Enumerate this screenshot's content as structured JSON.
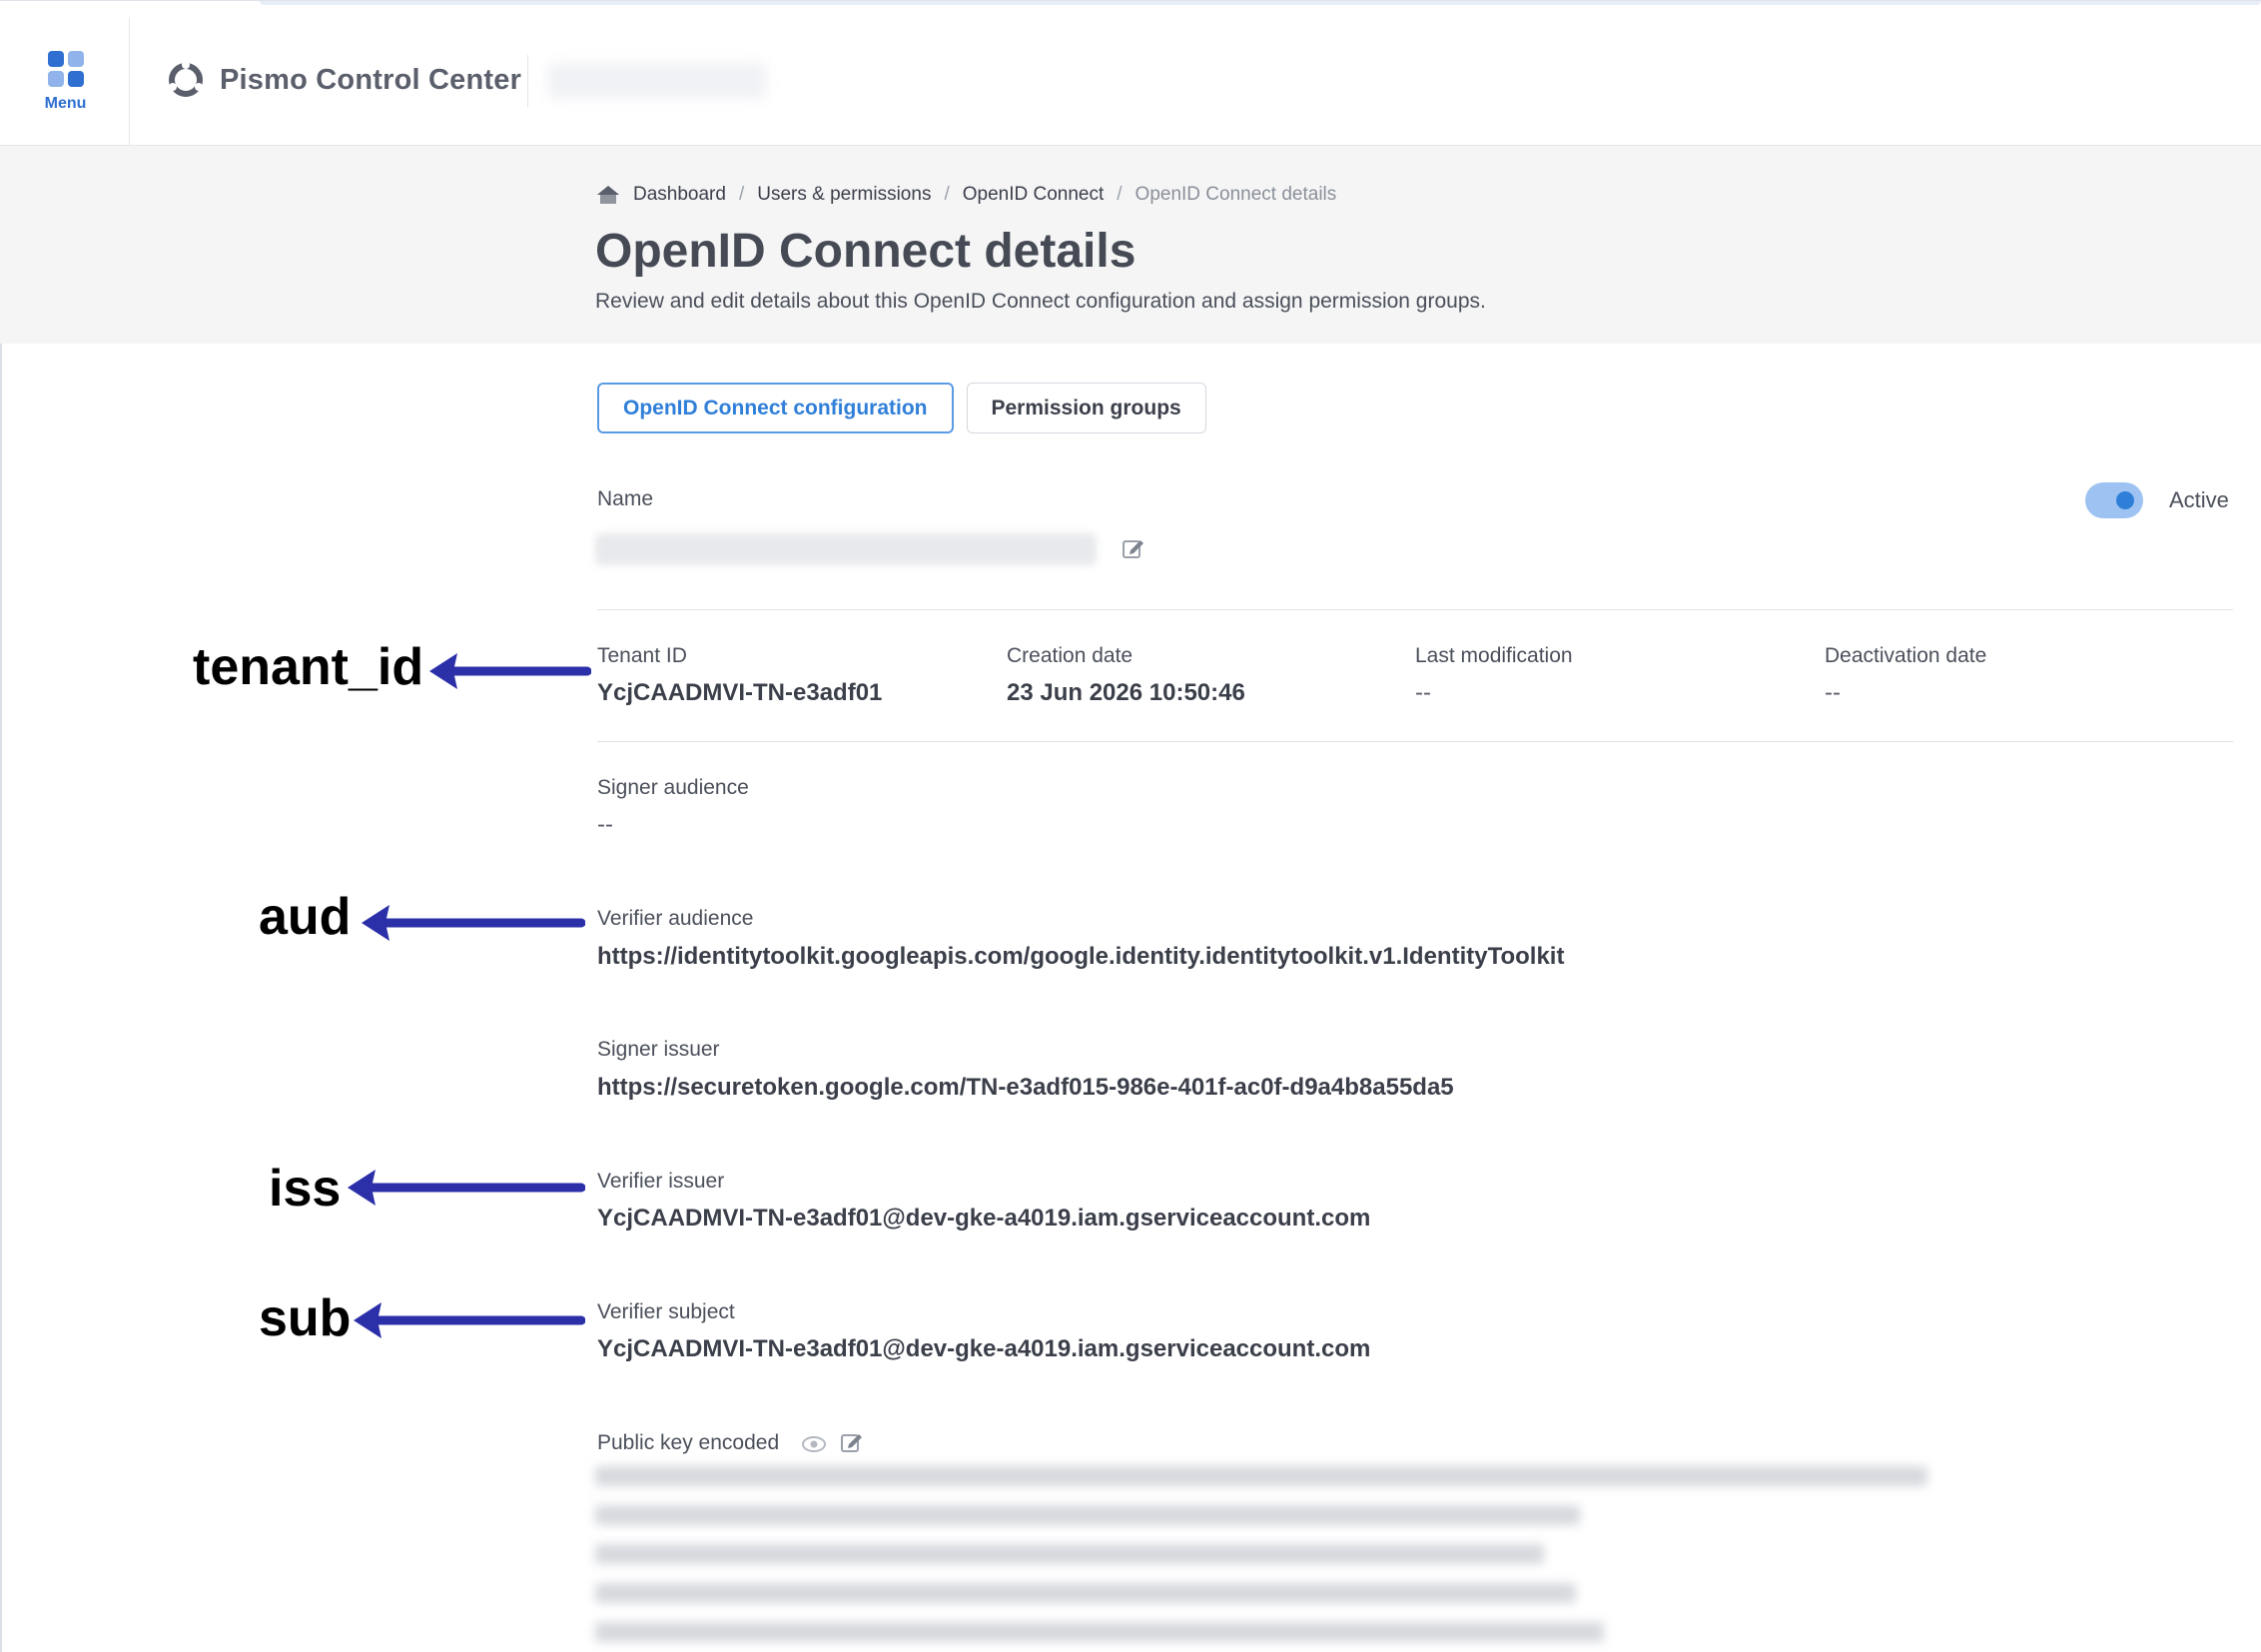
{
  "topbar": {
    "menu_label": "Menu",
    "brand_name": "Pismo Control Center"
  },
  "breadcrumb": {
    "items": [
      "Dashboard",
      "Users & permissions",
      "OpenID Connect",
      "OpenID Connect details"
    ],
    "separator": "/"
  },
  "header": {
    "title": "OpenID Connect details",
    "subtitle": "Review and edit details about this OpenID Connect configuration and assign permission groups."
  },
  "tabs": [
    {
      "label": "OpenID Connect configuration",
      "active": true
    },
    {
      "label": "Permission groups",
      "active": false
    }
  ],
  "details": {
    "name_label": "Name",
    "status_label": "Active",
    "status_on": true,
    "tenant_id_label": "Tenant ID",
    "tenant_id_value": "YcjCAADMVI-TN-e3adf01",
    "creation_date_label": "Creation date",
    "creation_date_value": "23 Jun 2026 10:50:46",
    "last_modification_label": "Last modification",
    "last_modification_value": "--",
    "deactivation_date_label": "Deactivation date",
    "deactivation_date_value": "--",
    "signer_audience_label": "Signer audience",
    "signer_audience_value": "--",
    "verifier_audience_label": "Verifier audience",
    "verifier_audience_value": "https://identitytoolkit.googleapis.com/google.identity.identitytoolkit.v1.IdentityToolkit",
    "signer_issuer_label": "Signer issuer",
    "signer_issuer_value": "https://securetoken.google.com/TN-e3adf015-986e-401f-ac0f-d9a4b8a55da5",
    "verifier_issuer_label": "Verifier issuer",
    "verifier_issuer_value": "YcjCAADMVI-TN-e3adf01@dev-gke-a4019.iam.gserviceaccount.com",
    "verifier_subject_label": "Verifier subject",
    "verifier_subject_value": "YcjCAADMVI-TN-e3adf01@dev-gke-a4019.iam.gserviceaccount.com",
    "public_key_label": "Public key encoded"
  },
  "annotations": {
    "tenant_id": "tenant_id",
    "aud": "aud",
    "iss": "iss",
    "sub": "sub",
    "color": "#2b2fa8"
  },
  "colors": {
    "accent": "#2f7fd8",
    "header_bg": "#f5f5f6",
    "arrow": "#2b2fa8"
  }
}
